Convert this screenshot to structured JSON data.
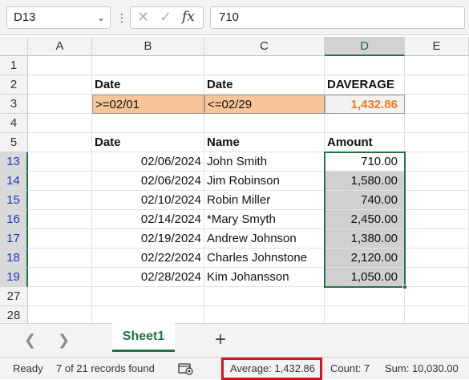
{
  "formula_bar": {
    "name_box": "D13",
    "formula": "710"
  },
  "columns": [
    "A",
    "B",
    "C",
    "D",
    "E"
  ],
  "rows": [
    "1",
    "2",
    "3",
    "4",
    "5",
    "13",
    "14",
    "15",
    "16",
    "17",
    "18",
    "19",
    "27",
    "28"
  ],
  "criteria": {
    "header_date1": "Date",
    "header_date2": "Date",
    "header_daverage": "DAVERAGE",
    "value_date1": ">=02/01",
    "value_date2": "<=02/29",
    "value_daverage": "1,432.86"
  },
  "table": {
    "headers": {
      "date": "Date",
      "name": "Name",
      "amount": "Amount"
    },
    "rows": [
      {
        "date": "02/06/2024",
        "name": "John Smith",
        "amount": "710.00"
      },
      {
        "date": "02/06/2024",
        "name": "Jim Robinson",
        "amount": "1,580.00"
      },
      {
        "date": "02/10/2024",
        "name": "Robin Miller",
        "amount": "740.00"
      },
      {
        "date": "02/14/2024",
        "name": "*Mary Smyth",
        "amount": "2,450.00"
      },
      {
        "date": "02/19/2024",
        "name": "Andrew Johnson",
        "amount": "1,380.00"
      },
      {
        "date": "02/22/2024",
        "name": "Charles Johnstone",
        "amount": "2,120.00"
      },
      {
        "date": "02/28/2024",
        "name": "Kim Johansson",
        "amount": "1,050.00"
      }
    ]
  },
  "sheet_tabs": {
    "active": "Sheet1",
    "add": "+"
  },
  "status_bar": {
    "ready": "Ready",
    "records": "7 of 21 records found",
    "average": "Average:  1,432.86",
    "count": "Count: 7",
    "sum": "Sum:  10,030.00"
  },
  "colors": {
    "accent": "#217346",
    "criteria_fill": "#f8c59b",
    "daverage_text": "#ef7b1e",
    "highlight_box": "#d8121e"
  }
}
